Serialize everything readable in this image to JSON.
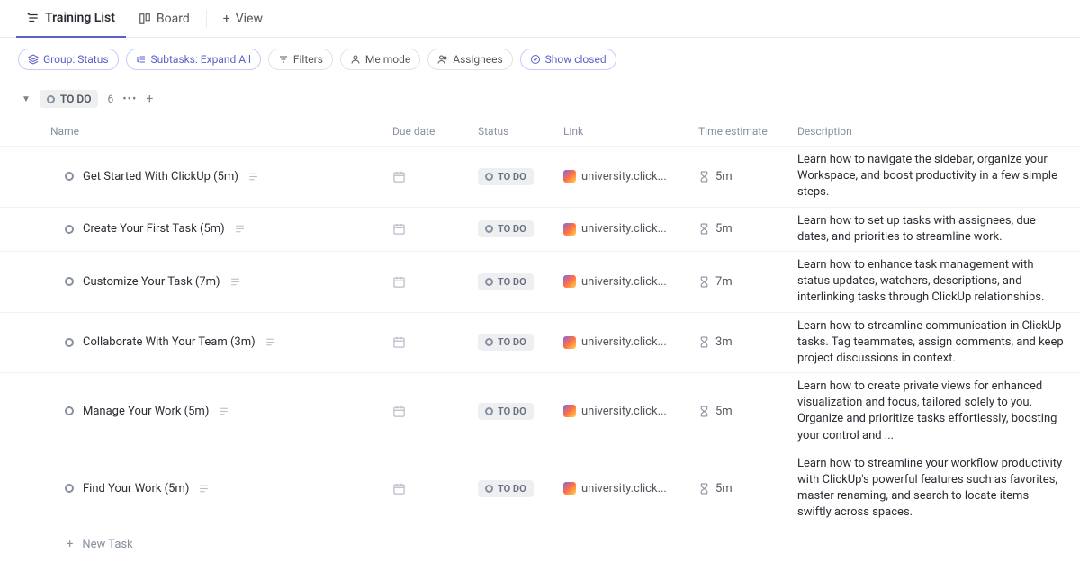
{
  "tabs": {
    "list": "Training List",
    "board": "Board",
    "addView": "View"
  },
  "filters": {
    "group": "Group: Status",
    "subtasks": "Subtasks: Expand All",
    "filters": "Filters",
    "meMode": "Me mode",
    "assignees": "Assignees",
    "showClosed": "Show closed"
  },
  "group": {
    "label": "TO DO",
    "count": "6"
  },
  "columns": {
    "name": "Name",
    "dueDate": "Due date",
    "status": "Status",
    "link": "Link",
    "timeEstimate": "Time estimate",
    "description": "Description"
  },
  "statusLabel": "TO DO",
  "linkText": "university.click...",
  "tasks": [
    {
      "name": "Get Started With ClickUp (5m)",
      "time": "5m",
      "desc": "Learn how to navigate the sidebar, organize your Workspace, and boost productivity in a few simple steps."
    },
    {
      "name": "Create Your First Task (5m)",
      "time": "5m",
      "desc": "Learn how to set up tasks with assignees, due dates, and priorities to streamline work."
    },
    {
      "name": "Customize Your Task (7m)",
      "time": "7m",
      "desc": "Learn how to enhance task management with status updates, watchers, descriptions, and interlinking tasks through ClickUp relationships."
    },
    {
      "name": "Collaborate With Your Team (3m)",
      "time": "3m",
      "desc": "Learn how to streamline communication in ClickUp tasks. Tag teammates, assign comments, and keep project discussions in context."
    },
    {
      "name": "Manage Your Work (5m)",
      "time": "5m",
      "desc": "Learn how to create private views for enhanced visualization and focus, tailored solely to you. Organize and prioritize tasks effortlessly, boosting your control and ..."
    },
    {
      "name": "Find Your Work (5m)",
      "time": "5m",
      "desc": "Learn how to streamline your workflow productivity with ClickUp's powerful features such as favorites, master renaming, and search to locate items swiftly across spaces."
    }
  ],
  "newTask": "New Task"
}
